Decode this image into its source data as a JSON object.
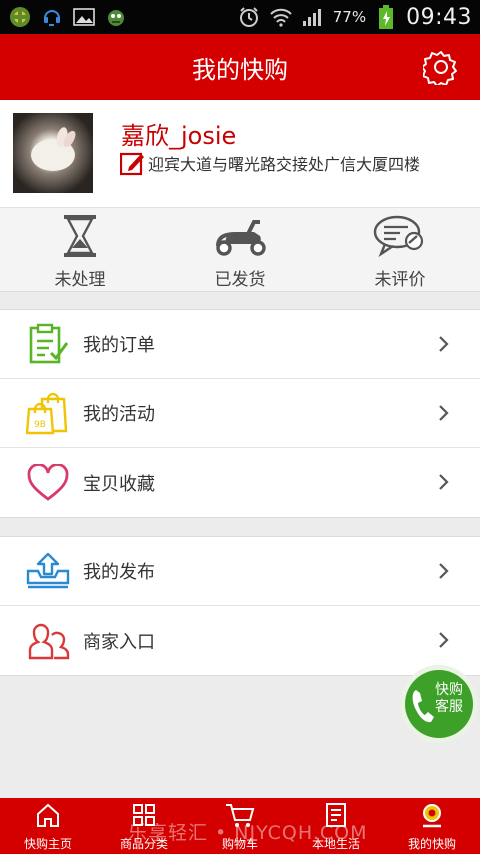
{
  "status_bar": {
    "battery_percent": "77%",
    "time": "09:43"
  },
  "header": {
    "title": "我的快购"
  },
  "profile": {
    "username": "嘉欣_josie",
    "address": "迎宾大道与曙光路交接处广信大厦四楼"
  },
  "order_status": [
    {
      "label": "未处理",
      "icon": "hourglass-icon"
    },
    {
      "label": "已发货",
      "icon": "scooter-icon"
    },
    {
      "label": "未评价",
      "icon": "review-bubble-icon"
    }
  ],
  "menu_group_1": [
    {
      "label": "我的订单",
      "icon": "clipboard-check-icon"
    },
    {
      "label": "我的活动",
      "icon": "shopping-bags-icon"
    },
    {
      "label": "宝贝收藏",
      "icon": "heart-icon"
    }
  ],
  "menu_group_2": [
    {
      "label": "我的发布",
      "icon": "upload-tray-icon"
    },
    {
      "label": "商家入口",
      "icon": "merchant-users-icon"
    }
  ],
  "floating_button": {
    "label": "快购客服"
  },
  "bottom_nav": [
    {
      "label": "快购主页",
      "icon": "home-icon"
    },
    {
      "label": "商品分类",
      "icon": "grid-icon"
    },
    {
      "label": "购物车",
      "icon": "cart-icon"
    },
    {
      "label": "本地生活",
      "icon": "local-life-icon"
    },
    {
      "label": "我的快购",
      "icon": "user-badge-icon"
    }
  ],
  "watermark": "乐享轻汇 • NJYCQH.COM",
  "colors": {
    "brand_red": "#d40000",
    "username_red": "#c80000",
    "service_green": "#3da028"
  }
}
